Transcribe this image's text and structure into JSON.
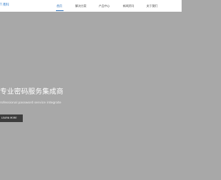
{
  "header": {
    "brand": "T 南科",
    "nav": [
      {
        "label": "首页",
        "active": true
      },
      {
        "label": "解决方案",
        "active": false
      },
      {
        "label": "产品中心",
        "active": false
      },
      {
        "label": "新闻资讯",
        "active": false
      },
      {
        "label": "关于我们",
        "active": false
      }
    ],
    "accent_color": "#1f67b5"
  },
  "hero": {
    "title": "专业密码服务集成商",
    "subtitle": "rofessional password service integrate",
    "button_label": "LEARN MORE",
    "background_color": "#a8a8a8"
  }
}
